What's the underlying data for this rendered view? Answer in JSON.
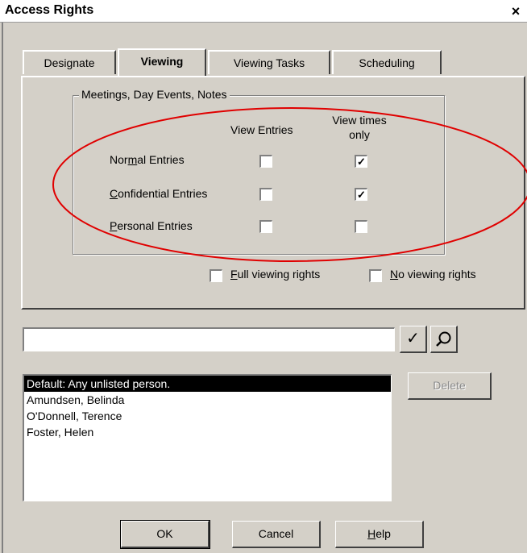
{
  "window": {
    "title": "Access Rights",
    "close_glyph": "×"
  },
  "tabs": [
    {
      "label": "Designate",
      "active": false
    },
    {
      "label": "Viewing",
      "active": true
    },
    {
      "label": "Viewing Tasks",
      "active": false
    },
    {
      "label": "Scheduling",
      "active": false
    }
  ],
  "group": {
    "label": "Meetings, Day Events, Notes",
    "col_view_entries": "View Entries",
    "col_view_times_line1": "View times",
    "col_view_times_line2": "only",
    "rows": [
      {
        "label_pre": "Nor",
        "label_ul": "m",
        "label_post": "al Entries",
        "view_entries": false,
        "view_times_only": true
      },
      {
        "label_pre": "",
        "label_ul": "C",
        "label_post": "onfidential Entries",
        "view_entries": false,
        "view_times_only": true
      },
      {
        "label_pre": "",
        "label_ul": "P",
        "label_post": "ersonal Entries",
        "view_entries": false,
        "view_times_only": false
      }
    ]
  },
  "full_viewing": {
    "ul": "F",
    "rest": "ull viewing rights",
    "checked": false
  },
  "no_viewing": {
    "ul": "N",
    "rest": "o viewing rights",
    "checked": false
  },
  "name_input": {
    "value": ""
  },
  "check_glyph": "✓",
  "list": {
    "items": [
      {
        "label": "Default: Any unlisted person.",
        "selected": true
      },
      {
        "label": "Amundsen, Belinda",
        "selected": false
      },
      {
        "label": "O'Donnell, Terence",
        "selected": false
      },
      {
        "label": "Foster, Helen",
        "selected": false
      }
    ]
  },
  "buttons": {
    "delete": "Delete",
    "ok": "OK",
    "cancel": "Cancel",
    "help_ul": "H",
    "help_rest": "elp"
  },
  "annotation": {
    "ellipse_color": "#e00000"
  }
}
